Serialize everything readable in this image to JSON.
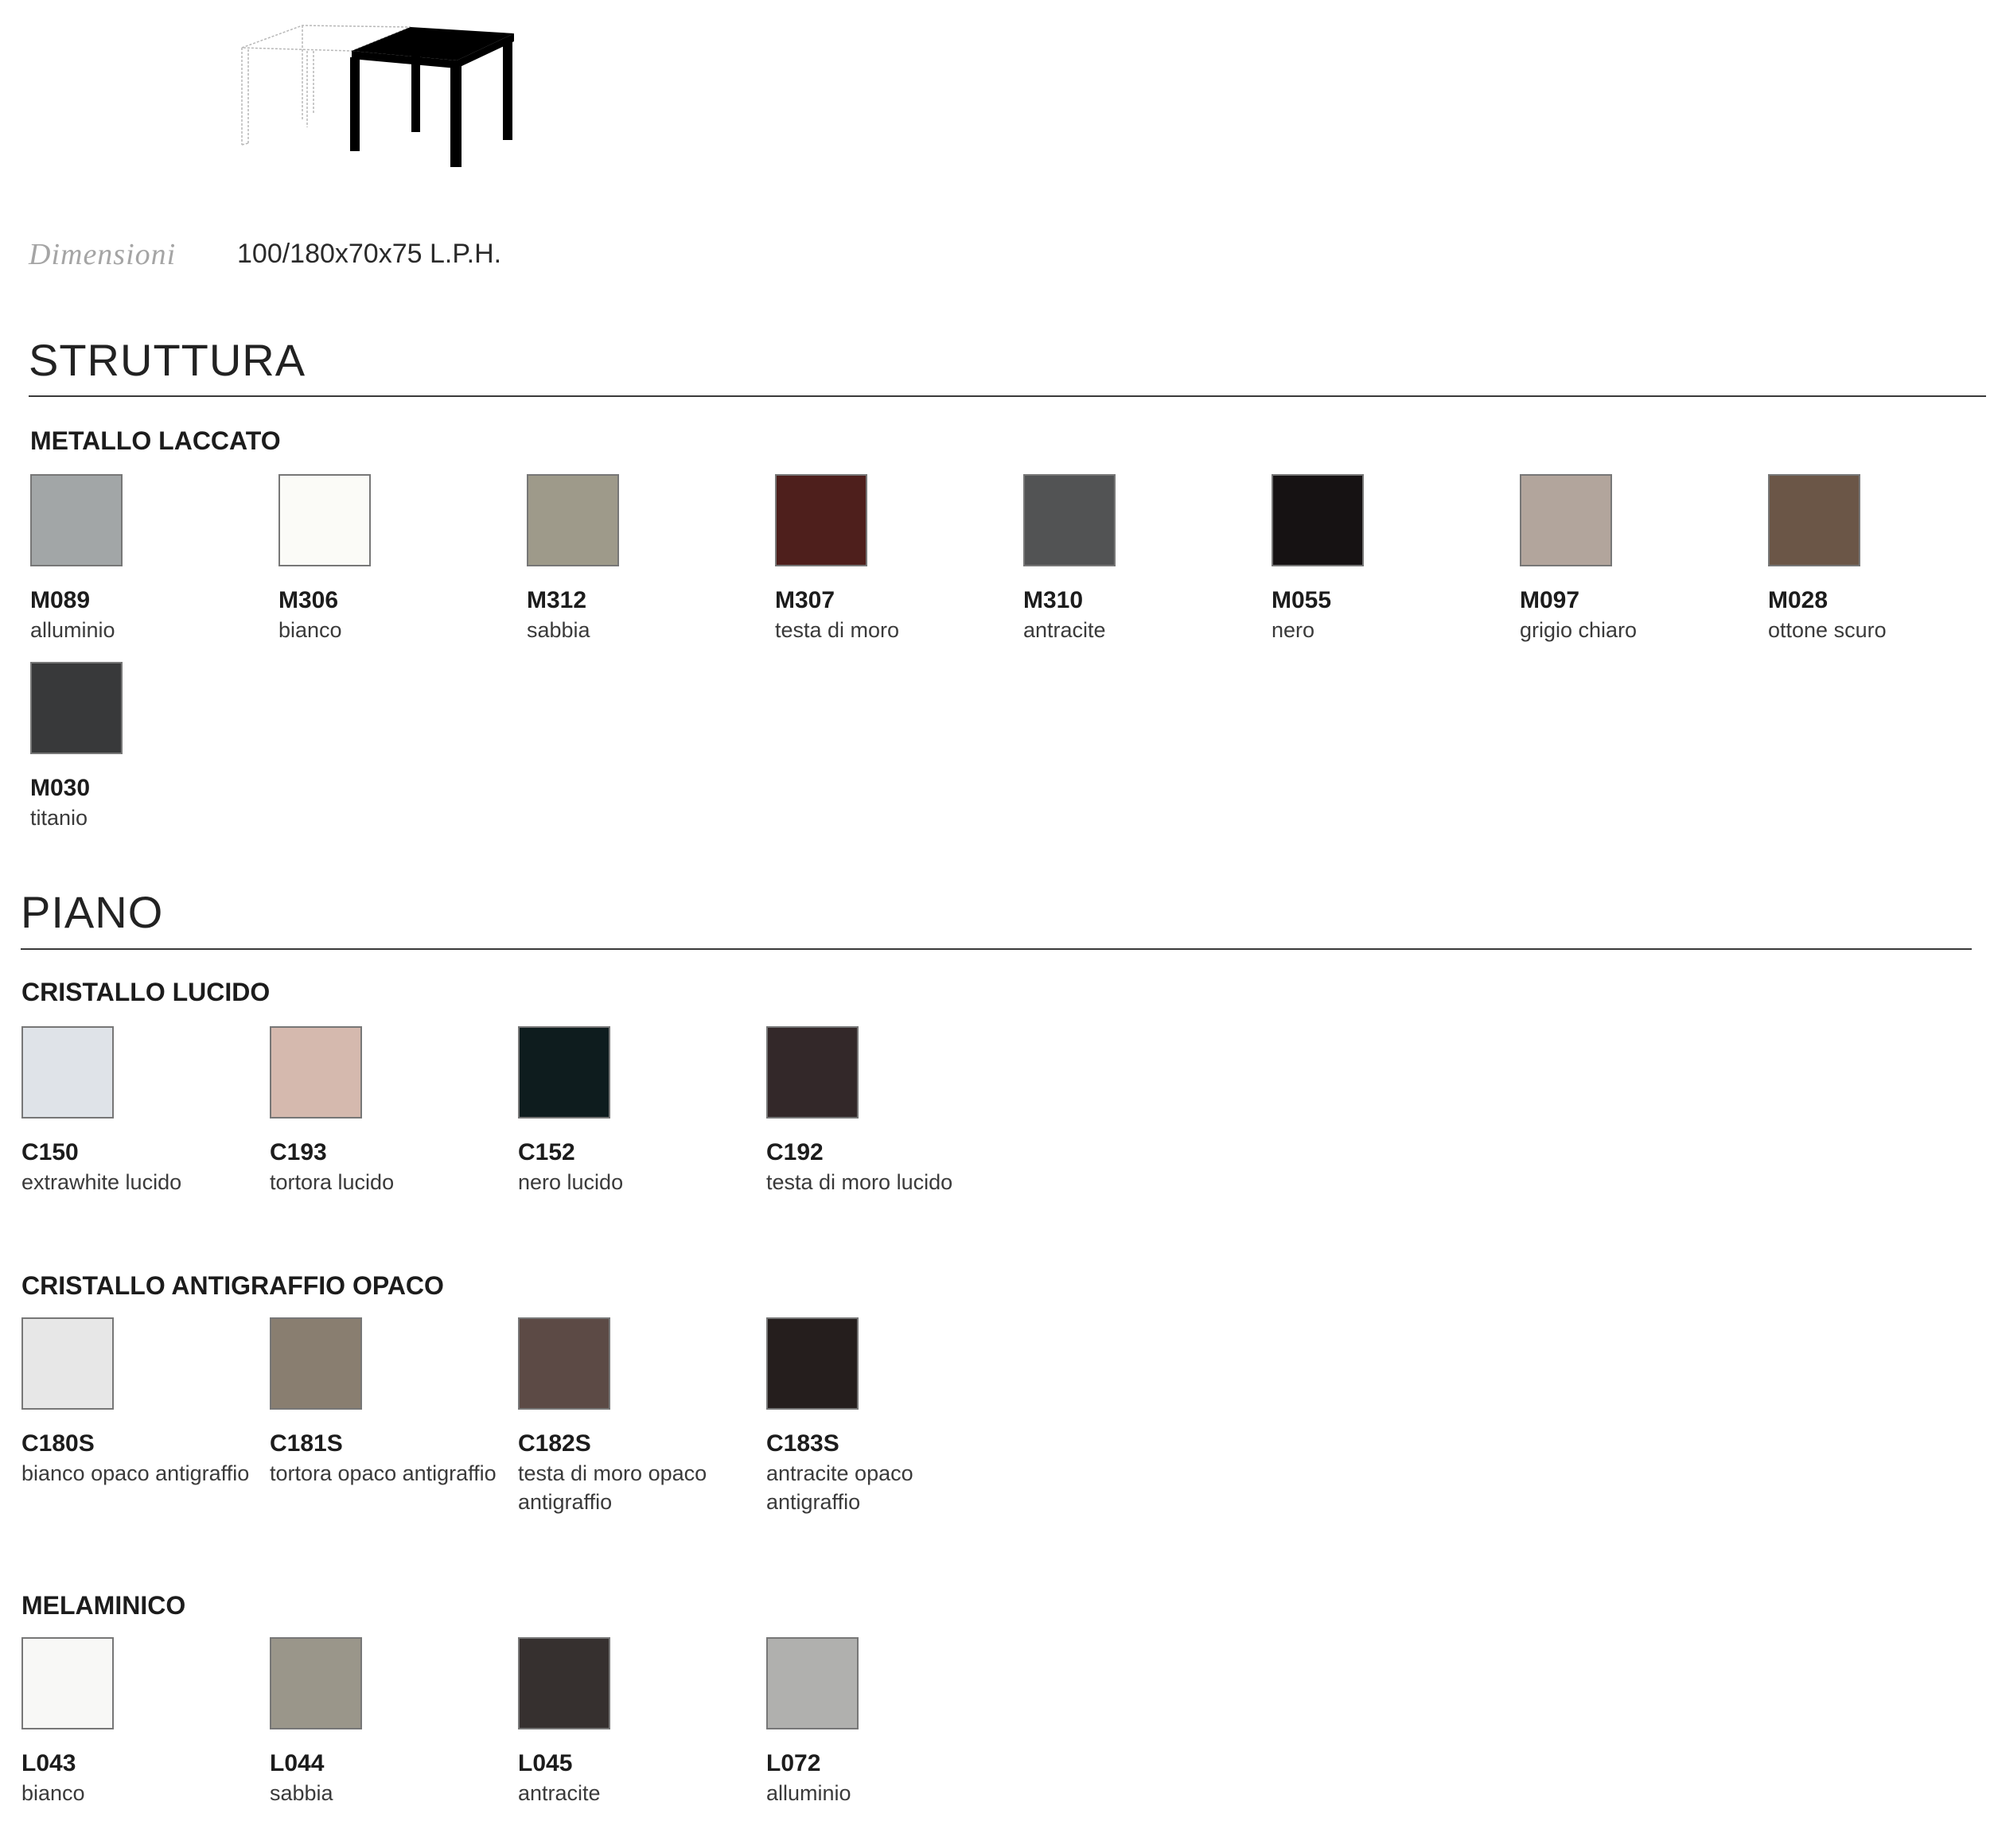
{
  "dimensions": {
    "label": "Dimensioni",
    "value": "100/180x70x75 L.P.H."
  },
  "struttura": {
    "title": "STRUTTURA",
    "group": "METALLO LACCATO",
    "row1": [
      {
        "code": "M089",
        "name": "alluminio",
        "color": "#a2a6a7"
      },
      {
        "code": "M306",
        "name": "bianco",
        "color": "#fbfbf7"
      },
      {
        "code": "M312",
        "name": "sabbia",
        "color": "#9e9a8a"
      },
      {
        "code": "M307",
        "name": "testa di moro",
        "color": "#4e1f1c"
      },
      {
        "code": "M310",
        "name": "antracite",
        "color": "#525354"
      },
      {
        "code": "M055",
        "name": "nero",
        "color": "#161213"
      },
      {
        "code": "M097",
        "name": "grigio chiaro",
        "color": "#b2a59c"
      },
      {
        "code": "M028",
        "name": "ottone scuro",
        "color": "#6b5647"
      }
    ],
    "row2": [
      {
        "code": "M030",
        "name": "titanio",
        "color": "#38393a"
      }
    ]
  },
  "piano": {
    "title": "PIANO",
    "cristallo_lucido": {
      "title": "CRISTALLO LUCIDO",
      "items": [
        {
          "code": "C150",
          "name": "extrawhite lucido",
          "color": "#dfe3e8"
        },
        {
          "code": "C193",
          "name": "tortora lucido",
          "color": "#d5b9ae"
        },
        {
          "code": "C152",
          "name": "nero lucido",
          "color": "#0e1c1e"
        },
        {
          "code": "C192",
          "name": "testa di moro lucido",
          "color": "#332829"
        }
      ]
    },
    "cristallo_opaco": {
      "title": "CRISTALLO ANTIGRAFFIO OPACO",
      "items": [
        {
          "code": "C180S",
          "name": "bianco opaco antigraffio",
          "color": "#e7e7e7"
        },
        {
          "code": "C181S",
          "name": "tortora opaco antigraffio",
          "color": "#897e70"
        },
        {
          "code": "C182S",
          "name": "testa di moro opaco antigraffio",
          "color": "#5c4a45"
        },
        {
          "code": "C183S",
          "name": "antracite opaco antigraffio",
          "color": "#251e1d"
        }
      ]
    },
    "melaminico": {
      "title": "MELAMINICO",
      "items": [
        {
          "code": "L043",
          "name": "bianco",
          "color": "#f8f8f6"
        },
        {
          "code": "L044",
          "name": "sabbia",
          "color": "#9a968a"
        },
        {
          "code": "L045",
          "name": "antracite",
          "color": "#36302f"
        },
        {
          "code": "L072",
          "name": "alluminio",
          "color": "#b0b0ae"
        }
      ]
    }
  }
}
